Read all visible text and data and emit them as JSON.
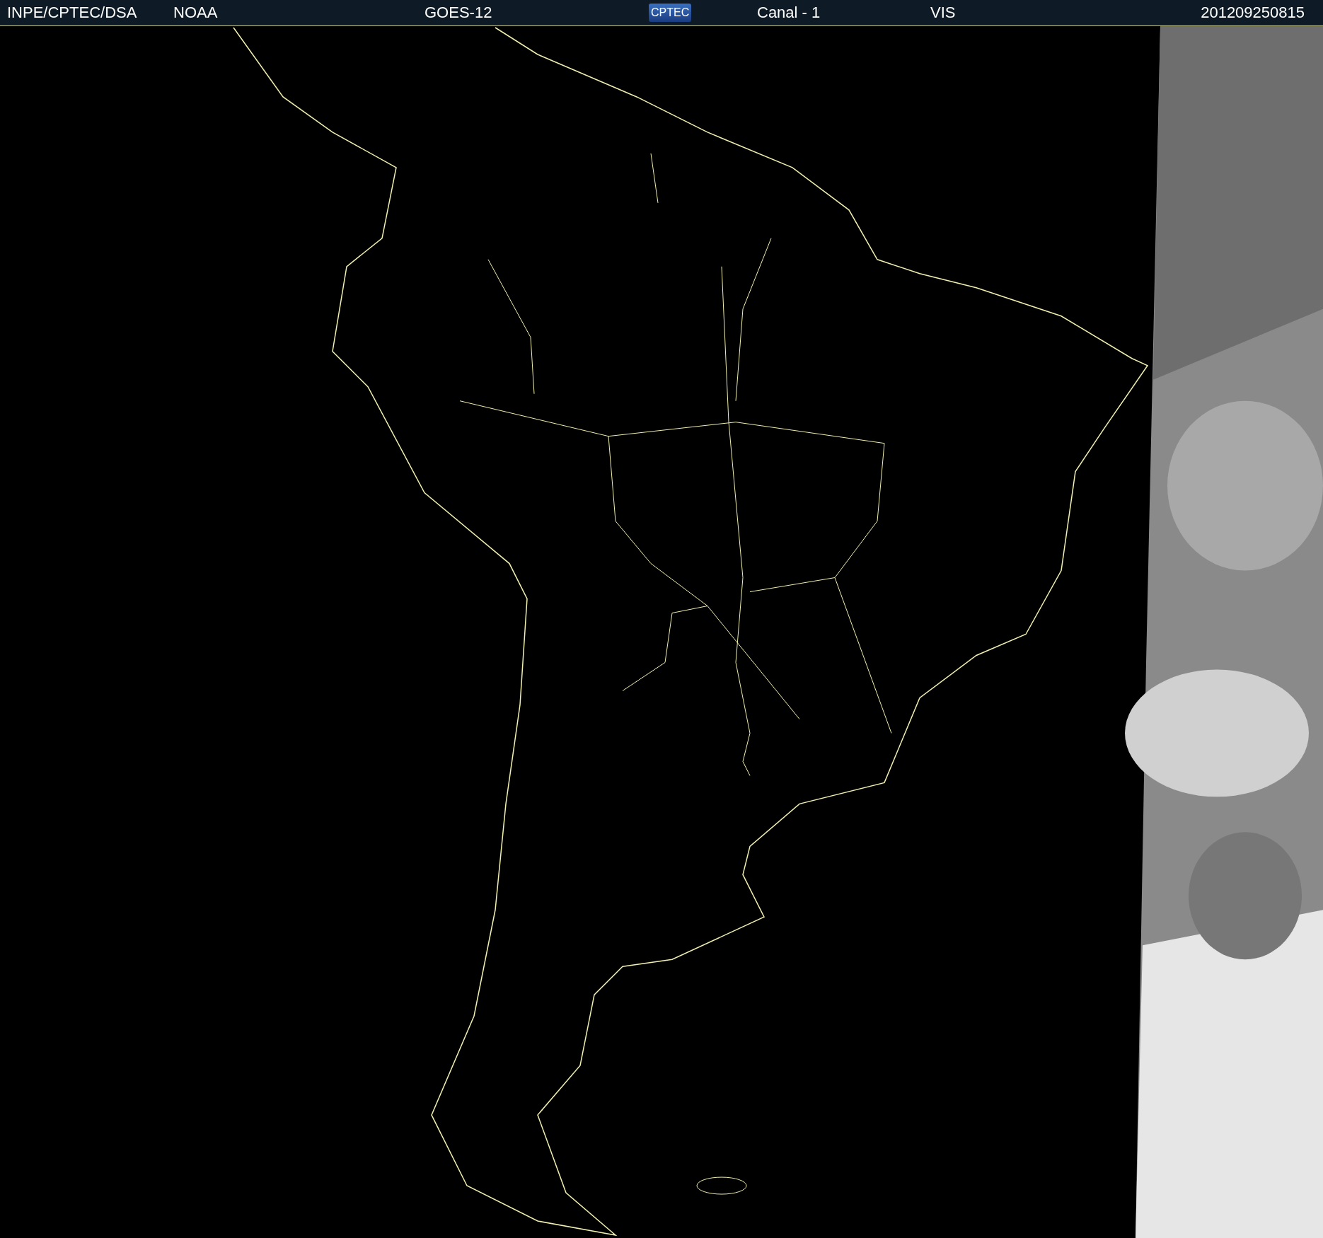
{
  "header": {
    "source": "INPE/CPTEC/DSA",
    "agency": "NOAA",
    "satellite": "GOES-12",
    "logo": "CPTEC",
    "channel": "Canal - 1",
    "band": "VIS",
    "timestamp": "201209250815"
  }
}
